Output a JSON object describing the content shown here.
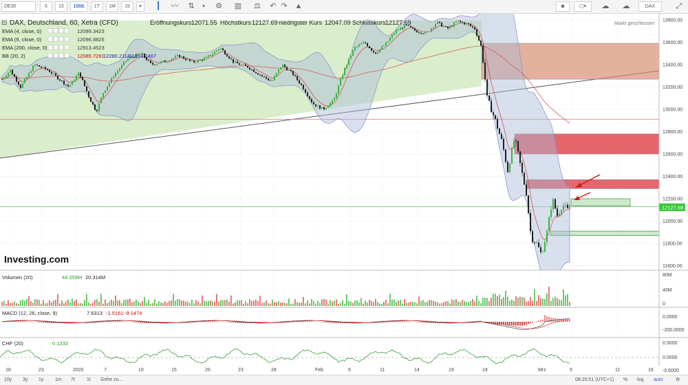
{
  "toolbar": {
    "symbol": "DE30",
    "intervals": [
      "5",
      "15",
      "1Std.",
      "1T",
      "1M",
      "15"
    ],
    "right_label": "DAX"
  },
  "header": {
    "instrument": "DAX, Deutschland, 60, Xetra (CFD)",
    "open_label": "Eröffnungskurs",
    "open_value": "12071.55",
    "high_label": "Höchstkurs",
    "high_value": "12127.69",
    "low_label": "niedrigster Kurs",
    "low_value": "12047.09",
    "close_label": "Schlusskurs",
    "close_value": "12127.69",
    "market_status": "Markt geschlossen"
  },
  "indicators": [
    {
      "name": "EMA (4, close, 0)",
      "values": [
        "12099.3423"
      ],
      "colors": [
        "#333333"
      ]
    },
    {
      "name": "EMA (9, close, 0)",
      "values": [
        "12096.8825"
      ],
      "colors": [
        "#333333"
      ]
    },
    {
      "name": "EMA (200, close, 0)",
      "values": [
        "12913.4523"
      ],
      "colors": [
        "#333333"
      ]
    },
    {
      "name": "BB (20, 2)",
      "values": [
        "12085.7291",
        "12280.2114",
        "11891.2467"
      ],
      "colors": [
        "#cc0000",
        "#1a1ab8",
        "#1a1ab8"
      ]
    }
  ],
  "logo": "Investing.com",
  "current_price": "12127.69",
  "volume_panel": {
    "label": "Volumen (20)",
    "v1": "44.359M",
    "v2": "20.314M",
    "ticks": [
      "80M",
      "40M",
      "0"
    ]
  },
  "macd_panel": {
    "label": "MACD (12, 26, close, 9)",
    "v1": "7.6313",
    "v2": "-1.5161",
    "v3": "-9.1474",
    "ticks": [
      "0.0000",
      "-200.0000"
    ]
  },
  "chf_panel": {
    "label": "CHF (20)",
    "v1": "0.1333",
    "ticks": [
      "0.5000",
      "0.0000",
      "-0.5000"
    ]
  },
  "bottom": {
    "ranges": [
      "10y",
      "3y",
      "1y",
      "1m",
      "7t",
      "1t"
    ],
    "goto": "Gehe zu...",
    "time": "08:20:51 (UTC+1)",
    "pct": "%",
    "log": "log",
    "auto": "auto"
  },
  "chart_data": {
    "type": "candlestick",
    "title": "DAX, Deutschland, 60, Xetra (CFD)",
    "y_ticks": [
      13800,
      13600,
      13400,
      13200,
      13000,
      12800,
      12600,
      12400,
      12200,
      12000,
      11800,
      11600
    ],
    "ylim": [
      11550,
      13870
    ],
    "x_tick_labels": [
      "18",
      "23",
      "2020",
      "7",
      "10",
      "15",
      "20",
      "23",
      "28",
      "Feb",
      "6",
      "11",
      "14",
      "19",
      "24",
      "Mrz",
      "5",
      "11",
      "16"
    ],
    "close_path": [
      [
        0,
        13250
      ],
      [
        15,
        13350
      ],
      [
        30,
        13200
      ],
      [
        50,
        13400
      ],
      [
        70,
        13350
      ],
      [
        90,
        13250
      ],
      [
        100,
        13200
      ],
      [
        115,
        13330
      ],
      [
        130,
        13100
      ],
      [
        140,
        12980
      ],
      [
        150,
        13150
      ],
      [
        165,
        13300
      ],
      [
        185,
        13450
      ],
      [
        205,
        13500
      ],
      [
        220,
        13400
      ],
      [
        240,
        13430
      ],
      [
        260,
        13480
      ],
      [
        280,
        13420
      ],
      [
        300,
        13460
      ],
      [
        320,
        13550
      ],
      [
        340,
        13420
      ],
      [
        360,
        13380
      ],
      [
        380,
        13300
      ],
      [
        395,
        13250
      ],
      [
        410,
        13400
      ],
      [
        425,
        13320
      ],
      [
        440,
        13200
      ],
      [
        455,
        13050
      ],
      [
        470,
        13000
      ],
      [
        485,
        13080
      ],
      [
        500,
        13350
      ],
      [
        515,
        13550
      ],
      [
        530,
        13600
      ],
      [
        545,
        13500
      ],
      [
        560,
        13580
      ],
      [
        575,
        13700
      ],
      [
        590,
        13750
      ],
      [
        605,
        13700
      ],
      [
        620,
        13680
      ],
      [
        635,
        13780
      ],
      [
        650,
        13720
      ],
      [
        665,
        13790
      ],
      [
        680,
        13760
      ],
      [
        690,
        13720
      ],
      [
        700,
        13550
      ],
      [
        708,
        13100
      ],
      [
        720,
        12900
      ],
      [
        730,
        12700
      ],
      [
        738,
        12450
      ],
      [
        748,
        12750
      ],
      [
        758,
        12450
      ],
      [
        765,
        12250
      ],
      [
        772,
        11850
      ],
      [
        780,
        11800
      ],
      [
        787,
        11700
      ],
      [
        795,
        11900
      ],
      [
        803,
        12200
      ],
      [
        810,
        12050
      ],
      [
        818,
        12150
      ],
      [
        825,
        12100
      ],
      [
        831,
        12128
      ]
    ],
    "series": [
      {
        "name": "EMA (4, close, 0)",
        "last": 12099.3423
      },
      {
        "name": "EMA (9, close, 0)",
        "last": 12096.8825
      },
      {
        "name": "EMA (200, close, 0)",
        "last": 12913.4523
      },
      {
        "name": "BB (20, 2)",
        "values": [
          12085.7291,
          12280.2114,
          11891.2467
        ]
      }
    ],
    "zones": [
      {
        "color": "#d7876c",
        "y1": 13590,
        "y2": 13270
      },
      {
        "color": "#e0404a",
        "y1": 12780,
        "y2": 12600
      },
      {
        "color": "#e0404a",
        "y1": 12370,
        "y2": 12290
      },
      {
        "color": "#9ad49a",
        "y1": 12200,
        "y2": 12135
      },
      {
        "color": "#9ad49a",
        "y1": 11910,
        "y2": 11870
      }
    ],
    "horizontal_lines": [
      {
        "y": 12910,
        "color": "#e07070"
      },
      {
        "y": 12128,
        "color": "#6fcf6f"
      }
    ],
    "volume_ticks": [
      80,
      40,
      0
    ],
    "macd_ticks": [
      0,
      -200
    ],
    "chf_ticks": [
      0.5,
      0,
      -0.5
    ]
  }
}
